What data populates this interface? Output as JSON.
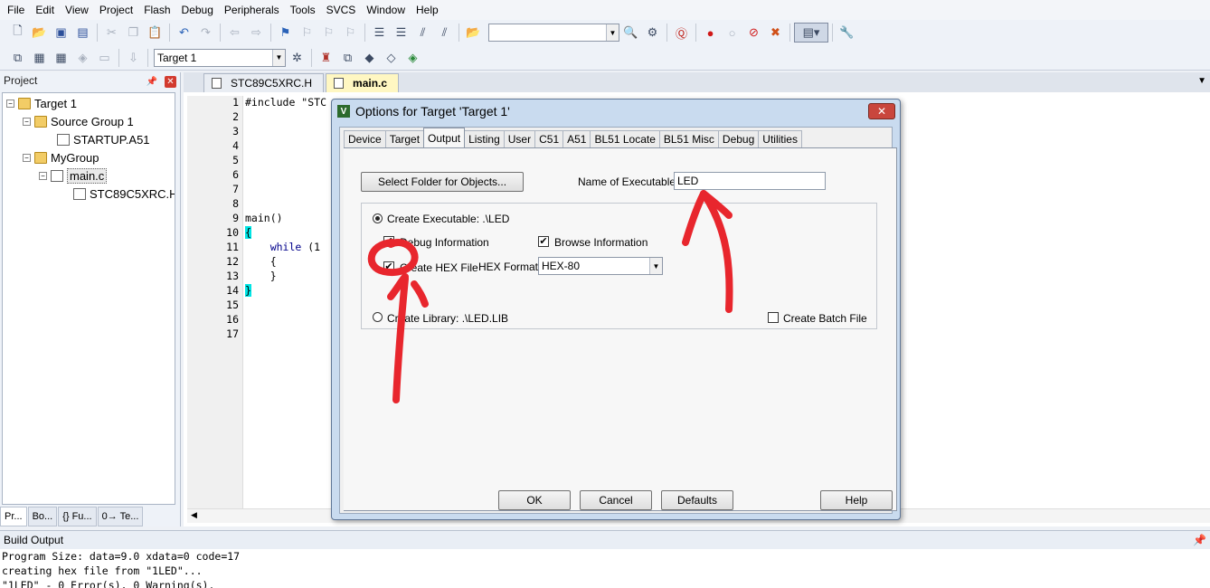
{
  "menu": [
    "File",
    "Edit",
    "View",
    "Project",
    "Flash",
    "Debug",
    "Peripherals",
    "Tools",
    "SVCS",
    "Window",
    "Help"
  ],
  "toolbar": {
    "find_combo_value": "",
    "target_combo_value": "Target 1"
  },
  "project_panel": {
    "title": "Project",
    "tree": {
      "target": "Target 1",
      "group1": "Source Group 1",
      "startup": "STARTUP.A51",
      "group2": "MyGroup",
      "main": "main.c",
      "header": "STC89C5XRC.H"
    },
    "bottom_tabs": [
      "Pr...",
      "Bo...",
      "{} Fu...",
      "0→ Te..."
    ]
  },
  "editor": {
    "tabs": [
      "STC89C5XRC.H",
      "main.c"
    ],
    "line_numbers": [
      "1",
      "2",
      "3",
      "4",
      "5",
      "6",
      "7",
      "8",
      "9",
      "10",
      "11",
      "12",
      "13",
      "14",
      "15",
      "16",
      "17"
    ],
    "code": {
      "l1": "#include \"STC",
      "l9": "main()",
      "l10": "{",
      "l11": "    while (1",
      "l12": "    {",
      "l13": "    }",
      "l14": "}"
    }
  },
  "build_output": {
    "title": "Build Output",
    "lines": [
      "Program Size: data=9.0 xdata=0 code=17",
      "creating hex file from \"1LED\"...",
      "\"1LED\" - 0 Error(s), 0 Warning(s)."
    ]
  },
  "dialog": {
    "title": "Options for Target 'Target 1'",
    "tabs": [
      "Device",
      "Target",
      "Output",
      "Listing",
      "User",
      "C51",
      "A51",
      "BL51 Locate",
      "BL51 Misc",
      "Debug",
      "Utilities"
    ],
    "active_tab": "Output",
    "select_folder_label": "Select Folder for Objects...",
    "name_of_executable_label": "Name of Executable:",
    "name_of_executable_value": "LED",
    "create_executable_label": "Create Executable:  .\\LED",
    "debug_info_label": "Debug Information",
    "browse_info_label": "Browse Information",
    "create_hex_label": "Create HEX File",
    "hex_format_label": "HEX Format:",
    "hex_format_value": "HEX-80",
    "create_library_label": "Create Library:  .\\LED.LIB",
    "create_batch_label": "Create Batch File",
    "ok_label": "OK",
    "cancel_label": "Cancel",
    "defaults_label": "Defaults",
    "help_label": "Help"
  },
  "colors": {
    "annotation": "#e8262d",
    "active_tab": "#fff7c2"
  },
  "icons": [
    "new-file-icon",
    "open-icon",
    "save-icon",
    "undo-icon",
    "build-icon",
    "debug-start-icon",
    "options-icon"
  ]
}
